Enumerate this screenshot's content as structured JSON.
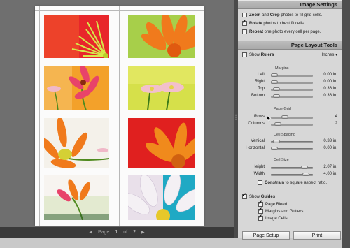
{
  "pager": {
    "prev_arrow": "◀",
    "page_label": "Page",
    "current": "1",
    "of_label": "of",
    "total": "2",
    "next_arrow": "▶"
  },
  "image_settings": {
    "title": "Image Settings",
    "zoom_crop": {
      "bold": "Zoom",
      "mid": " and ",
      "bold2": "Crop",
      "rest": " photos to fill grid cells.",
      "checked": false
    },
    "rotate": {
      "bold": "Rotate",
      "rest": " photos to best fit cells.",
      "checked": true
    },
    "repeat": {
      "bold": "Repeat",
      "rest": " one photo every cell per page.",
      "checked": false
    }
  },
  "layout_tools": {
    "title": "Page Layout Tools",
    "show_rulers": {
      "label": "Show ",
      "bold": "Rulers",
      "checked": false
    },
    "units": "Inches ▾",
    "margins": {
      "title": "Margins",
      "rows": [
        {
          "label": "Left",
          "value": "0.00 in.",
          "position": 0.0
        },
        {
          "label": "Right",
          "value": "0.00 in.",
          "position": 0.0
        },
        {
          "label": "Top",
          "value": "0.36 in.",
          "position": 0.05
        },
        {
          "label": "Bottom",
          "value": "0.36 in.",
          "position": 0.05
        }
      ]
    },
    "page_grid": {
      "title": "Page Grid",
      "rows": [
        {
          "label": "Rows",
          "value": "4",
          "position": 0.3
        },
        {
          "label": "Columns",
          "value": "2",
          "position": 0.1
        }
      ]
    },
    "cell_spacing": {
      "title": "Cell Spacing",
      "rows": [
        {
          "label": "Vertical",
          "value": "0.33 in.",
          "position": 0.05
        },
        {
          "label": "Horizontal",
          "value": "0.00 in.",
          "position": 0.0
        }
      ]
    },
    "cell_size": {
      "title": "Cell Size",
      "rows": [
        {
          "label": "Height",
          "value": "2.07 in.",
          "position": 0.85
        },
        {
          "label": "Width",
          "value": "4.00 in.",
          "position": 0.9
        }
      ],
      "constrain": {
        "bold": "Constrain",
        "rest": " to square aspect ratio.",
        "checked": false
      }
    },
    "show_guides": {
      "label": "Show ",
      "bold": "Guides",
      "checked": true
    },
    "guides": [
      {
        "label": "Page Bleed",
        "checked": true
      },
      {
        "label": "Margins and Gutters",
        "checked": true
      },
      {
        "label": "Image Cells",
        "checked": true
      }
    ]
  },
  "buttons": {
    "page_setup": "Page Setup",
    "print": "Print"
  },
  "colors": {
    "panel_bg": "#d7d7d7",
    "preview_bg": "#6f6f6f",
    "header_bg": "#b2b2b2"
  }
}
